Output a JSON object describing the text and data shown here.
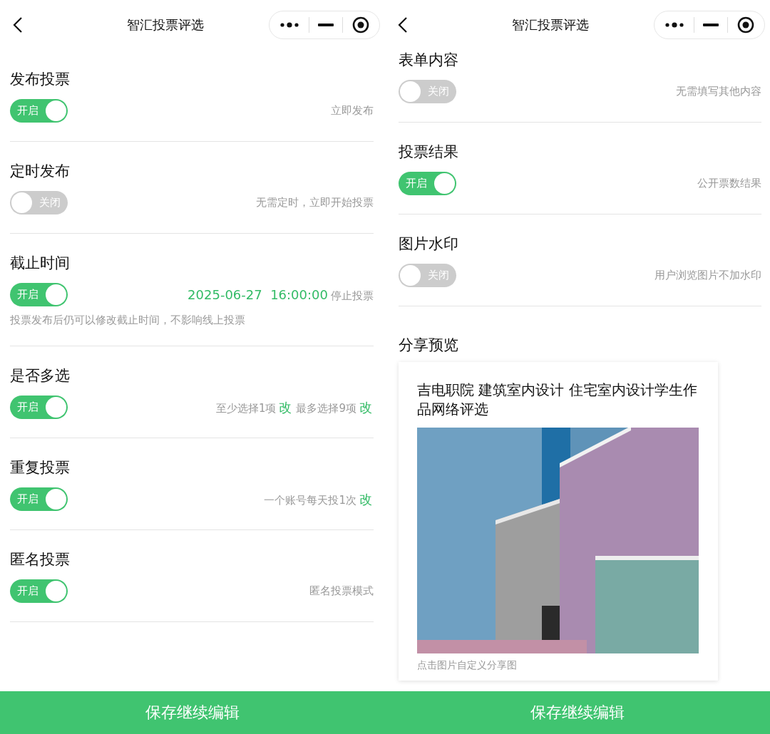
{
  "screens": [
    {
      "title": "智汇投票评选",
      "sections": [
        {
          "kind": "toggle",
          "title": "发布投票",
          "toggle": {
            "on": true,
            "label": "开启"
          },
          "detail": [
            {
              "kind": "plain",
              "text": "立即发布"
            }
          ]
        },
        {
          "kind": "toggle",
          "title": "定时发布",
          "toggle": {
            "on": false,
            "label": "关闭"
          },
          "detail": [
            {
              "kind": "plain",
              "text": "无需定时，立即开始投票"
            }
          ]
        },
        {
          "kind": "toggle",
          "title": "截止时间",
          "toggle": {
            "on": true,
            "label": "开启"
          },
          "detail": [
            {
              "kind": "accent",
              "text": "2025-06-27  16:00:00"
            },
            {
              "kind": "plain",
              "text": "停止投票"
            }
          ],
          "note": "投票发布后仍可以修改截止时间，不影响线上投票"
        },
        {
          "kind": "toggle",
          "title": "是否多选",
          "toggle": {
            "on": true,
            "label": "开启"
          },
          "detail": [
            {
              "kind": "plain",
              "text": "至少选择1项"
            },
            {
              "kind": "link",
              "text": "改"
            },
            {
              "kind": "plain",
              "text": "最多选择9项"
            },
            {
              "kind": "link",
              "text": "改"
            }
          ]
        },
        {
          "kind": "toggle",
          "title": "重复投票",
          "toggle": {
            "on": true,
            "label": "开启"
          },
          "detail": [
            {
              "kind": "plain",
              "text": "一个账号每天投1次"
            },
            {
              "kind": "link",
              "text": "改"
            }
          ]
        },
        {
          "kind": "toggle",
          "title": "匿名投票",
          "toggle": {
            "on": true,
            "label": "开启"
          },
          "detail": [
            {
              "kind": "plain",
              "text": "匿名投票模式"
            }
          ]
        }
      ],
      "save_button": "保存继续编辑"
    },
    {
      "title": "智汇投票评选",
      "sections": [
        {
          "kind": "toggle",
          "title": "表单内容",
          "toggle": {
            "on": false,
            "label": "关闭"
          },
          "detail": [
            {
              "kind": "plain",
              "text": "无需填写其他内容"
            }
          ]
        },
        {
          "kind": "toggle",
          "title": "投票结果",
          "toggle": {
            "on": true,
            "label": "开启"
          },
          "detail": [
            {
              "kind": "plain",
              "text": "公开票数结果"
            }
          ]
        },
        {
          "kind": "toggle",
          "title": "图片水印",
          "toggle": {
            "on": false,
            "label": "关闭"
          },
          "detail": [
            {
              "kind": "plain",
              "text": "用户浏览图片不加水印"
            }
          ]
        },
        {
          "kind": "share",
          "title": "分享预览",
          "card_title": "吉电职院 建筑室内设计 住宅室内设计学生作品网络评选",
          "caption": "点击图片自定义分享图"
        }
      ],
      "save_button": "保存继续编辑"
    }
  ]
}
